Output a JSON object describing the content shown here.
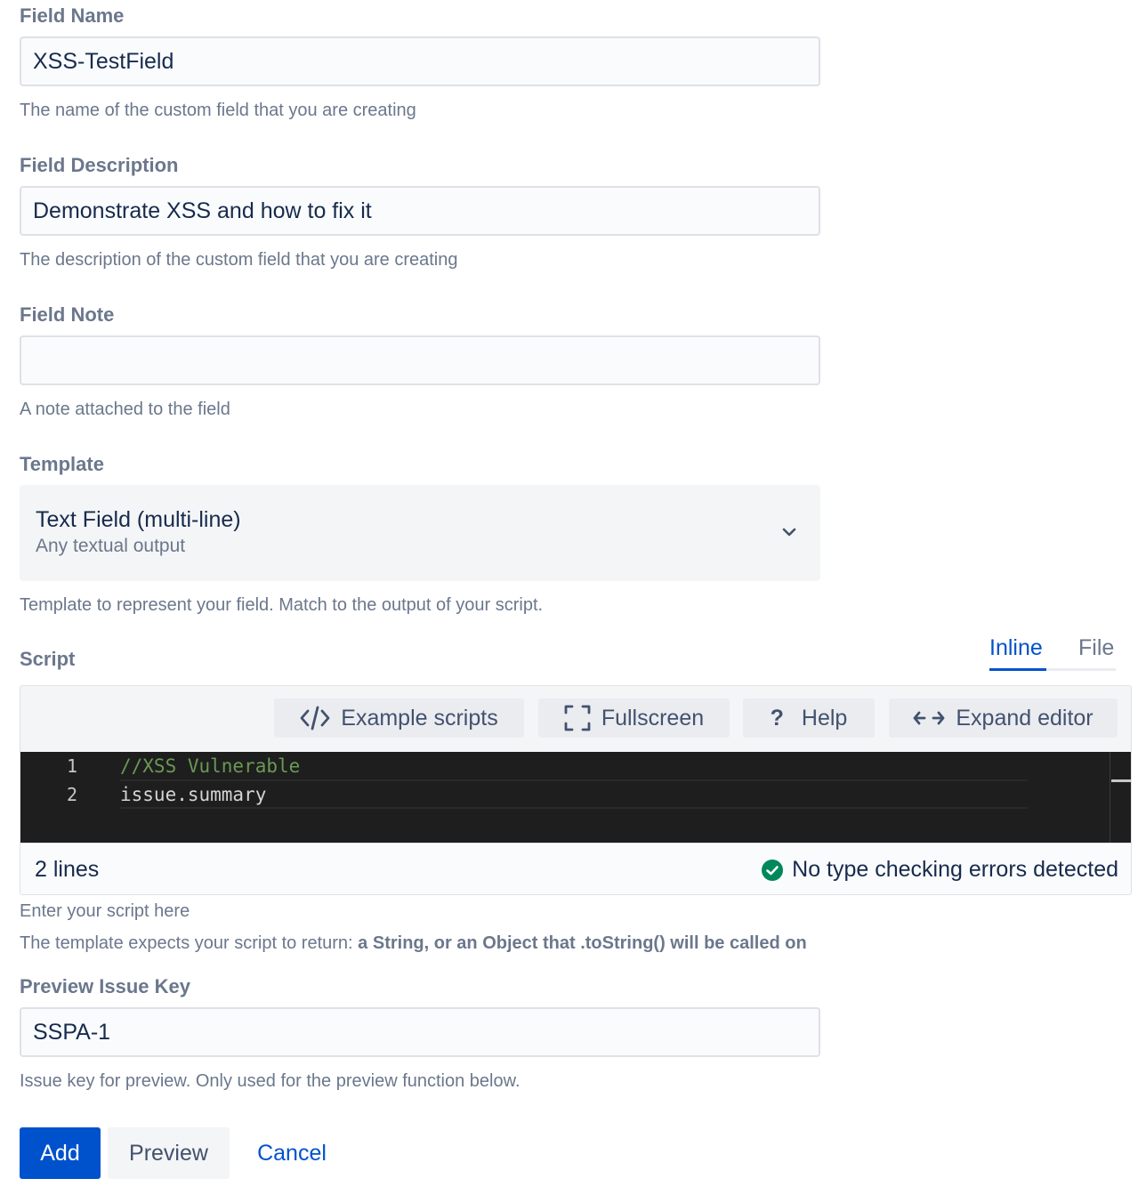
{
  "field_name": {
    "label": "Field Name",
    "value": "XSS-TestField",
    "help": "The name of the custom field that you are creating"
  },
  "field_description": {
    "label": "Field Description",
    "value": "Demonstrate XSS and how to fix it",
    "help": "The description of the custom field that you are creating"
  },
  "field_note": {
    "label": "Field Note",
    "value": "",
    "help": "A note attached to the field"
  },
  "template": {
    "label": "Template",
    "selected": "Text Field (multi-line)",
    "selected_desc": "Any textual output",
    "help": "Template to represent your field. Match to the output of your script."
  },
  "script": {
    "label": "Script",
    "tabs": [
      {
        "label": "Inline",
        "active": true
      },
      {
        "label": "File",
        "active": false
      }
    ],
    "toolbar": {
      "example_scripts": "Example scripts",
      "fullscreen": "Fullscreen",
      "help": "Help",
      "expand_editor": "Expand editor"
    },
    "lines": [
      {
        "num": "1",
        "text": "//XSS Vulnerable",
        "color": "#6a9955"
      },
      {
        "num": "2",
        "text": "issue.summary",
        "color": "#d4d4d4"
      }
    ],
    "line_count": "2 lines",
    "status": "No type checking errors detected",
    "help": "Enter your script here",
    "returns_prefix": "The template expects your script to return: ",
    "returns_value": "a String, or an Object that .toString() will be called on"
  },
  "preview_issue_key": {
    "label": "Preview Issue Key",
    "value": "SSPA-1",
    "help": "Issue key for preview. Only used for the preview function below."
  },
  "actions": {
    "add": "Add",
    "preview": "Preview",
    "cancel": "Cancel"
  },
  "colors": {
    "primary": "#0052cc",
    "success": "#00875a",
    "editor_bg": "#1e1e1e",
    "comment": "#6a9955"
  }
}
